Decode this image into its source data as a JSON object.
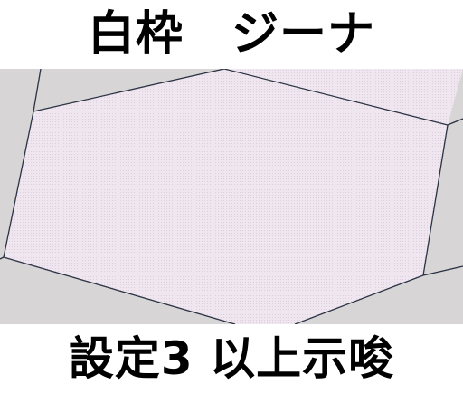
{
  "top_caption": "白枠　ジーナ",
  "bottom_caption": "設定3 以上示唆",
  "colors": {
    "background_gray": "#d8d5d6",
    "panel_fill": "#efe6ef",
    "outline": "#2b3344",
    "text": "#000000"
  }
}
